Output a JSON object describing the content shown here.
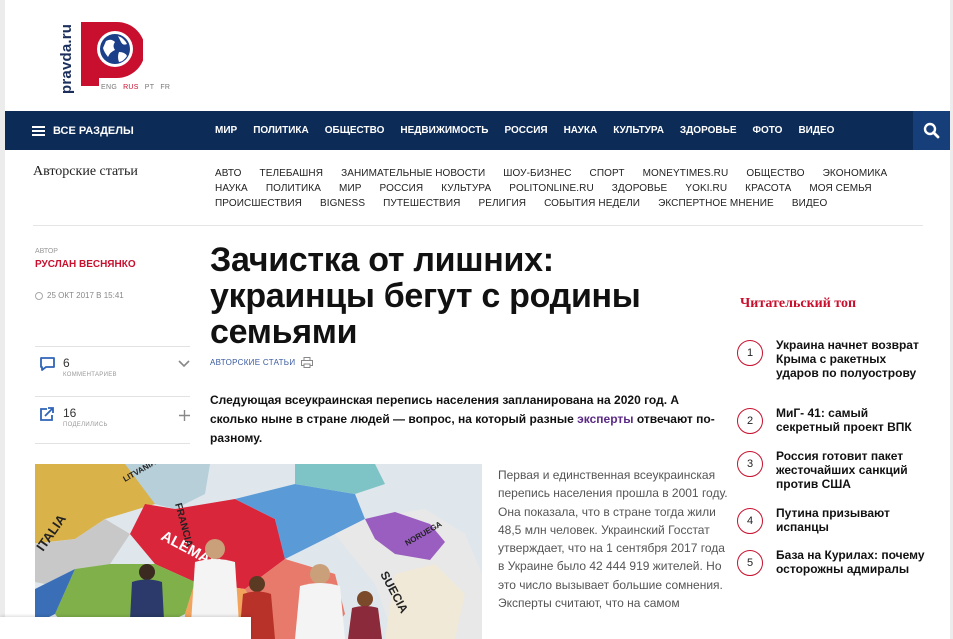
{
  "logo": {
    "text": "pravda.ru",
    "mark": "P"
  },
  "languages": [
    "ENG",
    "RUS",
    "PT",
    "FR"
  ],
  "nav": {
    "all_sections": "ВСЕ РАЗДЕЛЫ",
    "items": [
      "МИР",
      "ПОЛИТИКА",
      "ОБЩЕСТВО",
      "НЕДВИЖИМОСТЬ",
      "РОССИЯ",
      "НАУКА",
      "КУЛЬТУРА",
      "ЗДОРОВЬЕ",
      "ФОТО",
      "ВИДЕО"
    ]
  },
  "subnav": {
    "title": "Авторские статьи",
    "rows": [
      [
        "АВТО",
        "ТЕЛЕБАШНЯ",
        "ЗАНИМАТЕЛЬНЫЕ НОВОСТИ",
        "ШОУ-БИЗНЕС",
        "СПОРТ",
        "MONEYTIMES.RU",
        "ОБЩЕСТВО",
        "ЭКОНОМИКА"
      ],
      [
        "НАУКА",
        "ПОЛИТИКА",
        "МИР",
        "РОССИЯ",
        "КУЛЬТУРА",
        "POLITONLINE.RU",
        "ЗДОРОВЬЕ",
        "YOKI.RU",
        "КРАСОТА",
        "МОЯ СЕМЬЯ"
      ],
      [
        "ПРОИСШЕСТВИЯ",
        "BIGNESS",
        "ПУТЕШЕСТВИЯ",
        "РЕЛИГИЯ",
        "СОБЫТИЯ НЕДЕЛИ",
        "ЭКСПЕРТНОЕ МНЕНИЕ",
        "ВИДЕО"
      ]
    ]
  },
  "article": {
    "author_caption": "АВТОР",
    "author_name": "РУСЛАН ВЕСНЯНКО",
    "date": "25 ОКТ 2017 В 15:41",
    "comments_count": "6",
    "comments_caption": "КОММЕНТАРИЕВ",
    "shares_count": "16",
    "shares_caption": "ПОДЕЛИЛИСЬ",
    "title_lines": [
      "Зачистка от лишних:",
      "украинцы бегут с родины",
      "семьями"
    ],
    "category": "АВТОРСКИЕ СТАТЬИ",
    "lead_before": "Следующая всеукраинская перепись населения запланирована на 2020 год. А сколько ныне в стране людей — вопрос, на который разные ",
    "lead_link": "эксперты",
    "lead_after": " отвечают по-разному.",
    "body": "Первая и единственная всеукраинская перепись населения прошла в 2001 году. Она показала, что в стране тогда жили 48,5 млн человек. Украинский Госстат утверждает, что на 1 сентября 2017 года в Украине было 42 444 919 жителей. Но это число вызывает большие сомнения. Эксперты считают, что на самом",
    "map_labels": [
      "ALEMANIA",
      "FRANCIA",
      "ITALIA",
      "SUECIA",
      "NORUEGA",
      "LITVANIA"
    ]
  },
  "reader_top": {
    "title": "Читательский топ",
    "items": [
      {
        "n": "1",
        "text": "Украина начнет возврат Крыма с ракетных ударов по полуострову"
      },
      {
        "n": "2",
        "text": "МиГ- 41: самый секретный проект ВПК"
      },
      {
        "n": "3",
        "text": "Россия готовит пакет жесточайших санкций против США"
      },
      {
        "n": "4",
        "text": "Путина призывают испанцы"
      },
      {
        "n": "5",
        "text": "База на Курилах: почему осторожны адмиралы"
      }
    ]
  },
  "colors": {
    "navy": "#0d2b57",
    "red": "#c8102e",
    "link": "#5b2a86"
  }
}
